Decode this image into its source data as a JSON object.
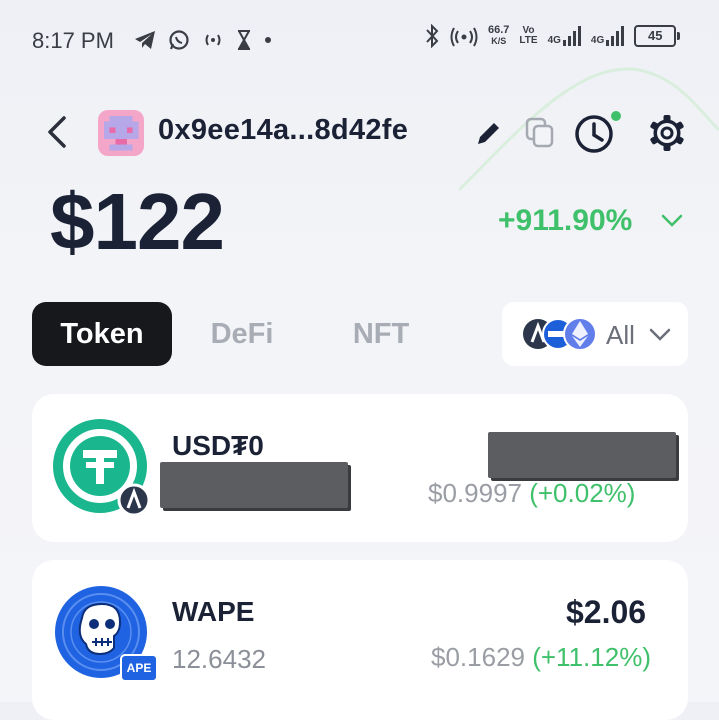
{
  "status_bar": {
    "time": "8:17 PM",
    "speed_value": "66.7",
    "speed_unit": "K/S",
    "vo_top": "Vo",
    "vo_bottom": "LTE",
    "net1": "4G",
    "net2": "4G",
    "battery": "45"
  },
  "header": {
    "address": "0x9ee14a...8d42fe",
    "balance": "$122",
    "change": "+911.90%"
  },
  "tabs": [
    {
      "label": "Token",
      "active": true
    },
    {
      "label": "DeFi",
      "active": false
    },
    {
      "label": "NFT",
      "active": false
    }
  ],
  "chain_filter": {
    "label": "All"
  },
  "tokens": [
    {
      "symbol": "USD₮0",
      "amount": "",
      "value": "",
      "price": "$0.9997",
      "change": "(+0.02%)",
      "amount_redacted": true,
      "value_redacted": true
    },
    {
      "symbol": "WAPE",
      "amount": "12.6432",
      "value": "$2.06",
      "price": "$0.1629",
      "change": "(+11.12%)",
      "badge": "APE"
    }
  ],
  "colors": {
    "accent_green": "#3fc06a",
    "tether_green": "#1ab68d",
    "ape_blue": "#1f63e2",
    "dark": "#1b2235"
  }
}
